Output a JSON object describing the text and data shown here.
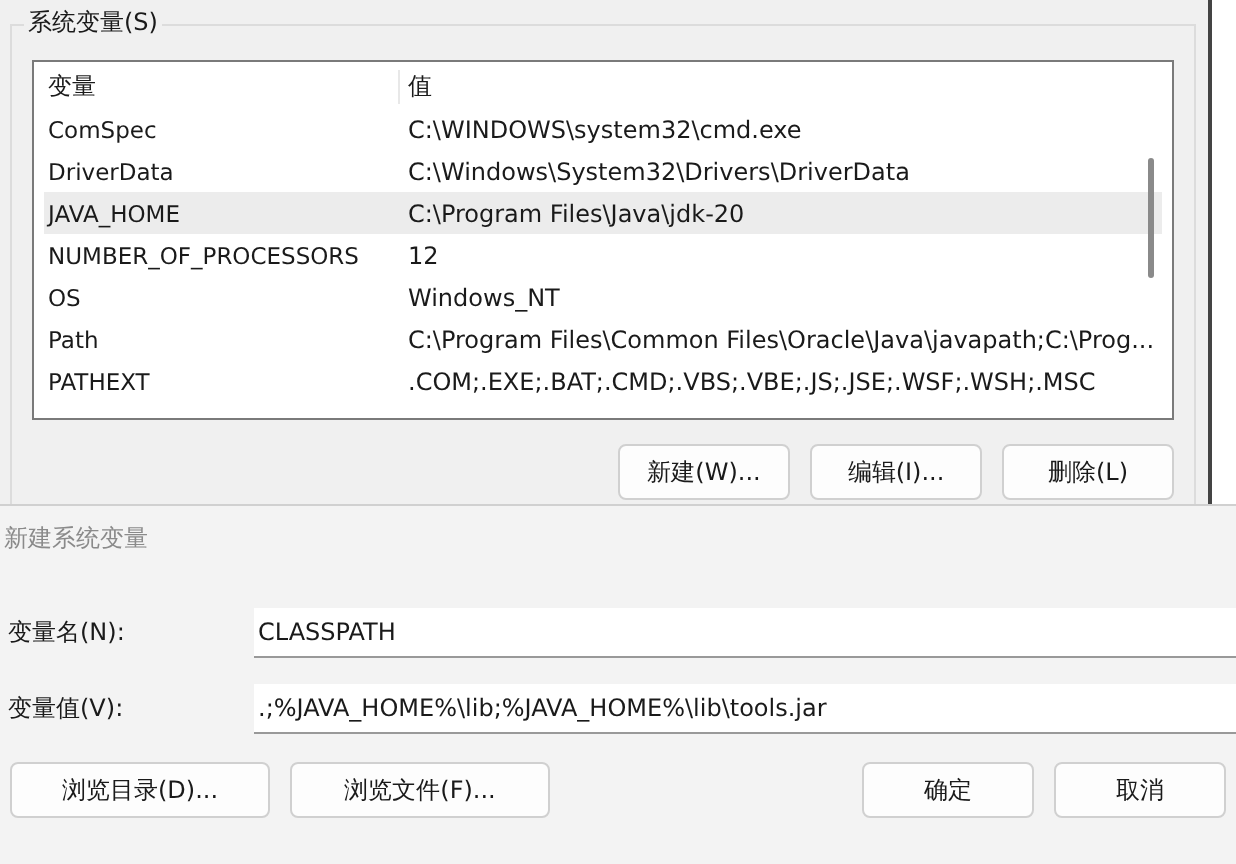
{
  "system_variables": {
    "group_title": "系统变量(S)",
    "columns": [
      "变量",
      "值"
    ],
    "rows": [
      {
        "name": "ComSpec",
        "value": "C:\\WINDOWS\\system32\\cmd.exe",
        "selected": false
      },
      {
        "name": "DriverData",
        "value": "C:\\Windows\\System32\\Drivers\\DriverData",
        "selected": false
      },
      {
        "name": "JAVA_HOME",
        "value": "C:\\Program Files\\Java\\jdk-20",
        "selected": true
      },
      {
        "name": "NUMBER_OF_PROCESSORS",
        "value": "12",
        "selected": false
      },
      {
        "name": "OS",
        "value": "Windows_NT",
        "selected": false
      },
      {
        "name": "Path",
        "value": "C:\\Program Files\\Common Files\\Oracle\\Java\\javapath;C:\\Prog...",
        "selected": false
      },
      {
        "name": "PATHEXT",
        "value": ".COM;.EXE;.BAT;.CMD;.VBS;.VBE;.JS;.JSE;.WSF;.WSH;.MSC",
        "selected": false
      }
    ],
    "buttons": [
      "新建(W)...",
      "编辑(I)...",
      "删除(L)"
    ]
  },
  "dialog": {
    "title": "新建系统变量",
    "fields": [
      {
        "label": "变量名(N):",
        "value": "CLASSPATH"
      },
      {
        "label": "变量值(V):",
        "value": ".;%JAVA_HOME%\\lib;%JAVA_HOME%\\lib\\tools.jar"
      }
    ],
    "left_buttons": [
      "浏览目录(D)...",
      "浏览文件(F)..."
    ],
    "right_buttons": [
      "确定",
      "取消"
    ]
  }
}
